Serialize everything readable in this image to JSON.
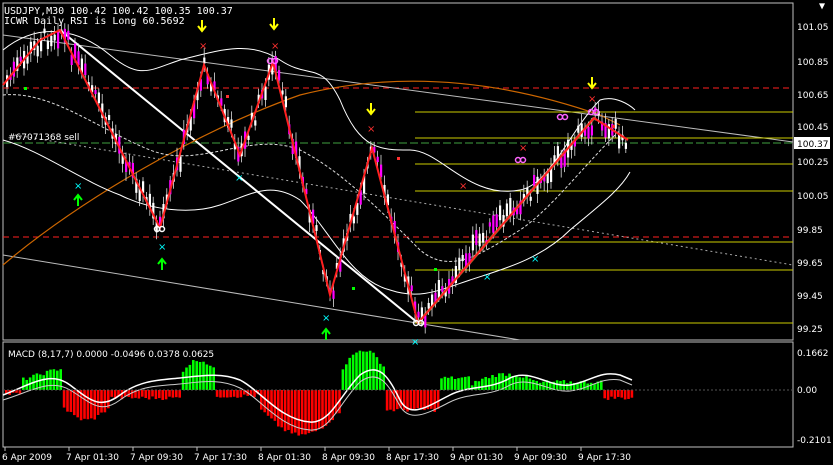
{
  "window": {
    "symbol_line": "USDJPY,M30  100.42 100.42 100.35 100.37",
    "indicator_line": "ICWR Daily RSI is Long 60.5692",
    "order_label": "#67071368 sell",
    "macd_label": "MACD  (8,17,7) 0.0000 -0.0496 0.0378 0.0625",
    "current_price": "100.37"
  },
  "price_axis": [
    "101.05",
    "100.85",
    "100.65",
    "100.45",
    "100.25",
    "100.05",
    "99.85",
    "99.65",
    "99.45",
    "99.25"
  ],
  "macd_axis": [
    "0.1662",
    "0.00",
    "-0.2101"
  ],
  "time_axis": [
    "6 Apr 2009",
    "7 Apr 01:30",
    "7 Apr 09:30",
    "7 Apr 17:30",
    "8 Apr 01:30",
    "8 Apr 09:30",
    "8 Apr 17:30",
    "9 Apr 01:30",
    "9 Apr 09:30",
    "9 Apr 17:30"
  ],
  "colors": {
    "background": "#000000",
    "bull_candle": "#ff00ff",
    "bear_candle": "#ffffff",
    "zigzag": "#ff2020",
    "trend": "#ffffff",
    "fib": "#ffff00",
    "histo_pos": "#00ff00",
    "histo_neg": "#ff0000",
    "arrow_up": "#00ff00",
    "arrow_down": "#ffff00",
    "cross": "#00ffff"
  }
}
